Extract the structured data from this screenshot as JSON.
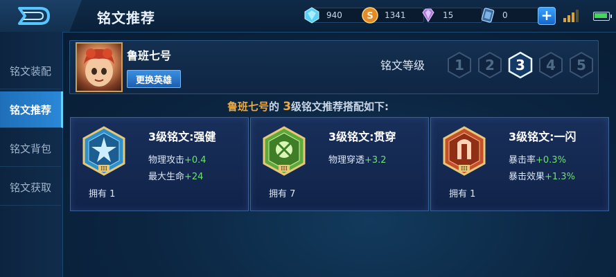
{
  "header": {
    "title": "铭文推荐"
  },
  "resources": [
    {
      "name": "diamond",
      "icon": "diamond-icon",
      "value": "940"
    },
    {
      "name": "coupon",
      "icon": "coin-icon",
      "value": "1341"
    },
    {
      "name": "gem",
      "icon": "gem-icon",
      "value": "15"
    },
    {
      "name": "voucher",
      "icon": "voucher-icon",
      "value": "0"
    }
  ],
  "sidebar": {
    "items": [
      {
        "label": "铭文装配"
      },
      {
        "label": "铭文推荐",
        "active": true
      },
      {
        "label": "铭文背包"
      },
      {
        "label": "铭文获取"
      }
    ]
  },
  "hero": {
    "name": "鲁班七号",
    "change_button": "更换英雄"
  },
  "level": {
    "label": "铭文等级",
    "options": [
      "1",
      "2",
      "3",
      "4",
      "5"
    ],
    "selected": "3"
  },
  "recommendation": {
    "hero": "鲁班七号",
    "connector": "的 ",
    "level": "3",
    "rest": "级铭文推荐搭配如下:"
  },
  "runes": [
    {
      "name": "3级铭文:强健",
      "color": "#2f8fc9",
      "stats": [
        {
          "label": "物理攻击",
          "value": "+0.4"
        },
        {
          "label": "最大生命",
          "value": "+24"
        }
      ],
      "owned": "拥有 1"
    },
    {
      "name": "3级铭文:贯穿",
      "color": "#5fa83a",
      "stats": [
        {
          "label": "物理穿透",
          "value": "+3.2"
        }
      ],
      "owned": "拥有 7"
    },
    {
      "name": "3级铭文:一闪",
      "color": "#c4502a",
      "stats": [
        {
          "label": "暴击率",
          "value": "+0.3%"
        },
        {
          "label": "暴击效果",
          "value": "+1.3%"
        }
      ],
      "owned": "拥有 1"
    }
  ],
  "colors": {
    "accent": "#2a88d8",
    "highlight": "#f0a93a",
    "stat_positive": "#6ee26f"
  }
}
